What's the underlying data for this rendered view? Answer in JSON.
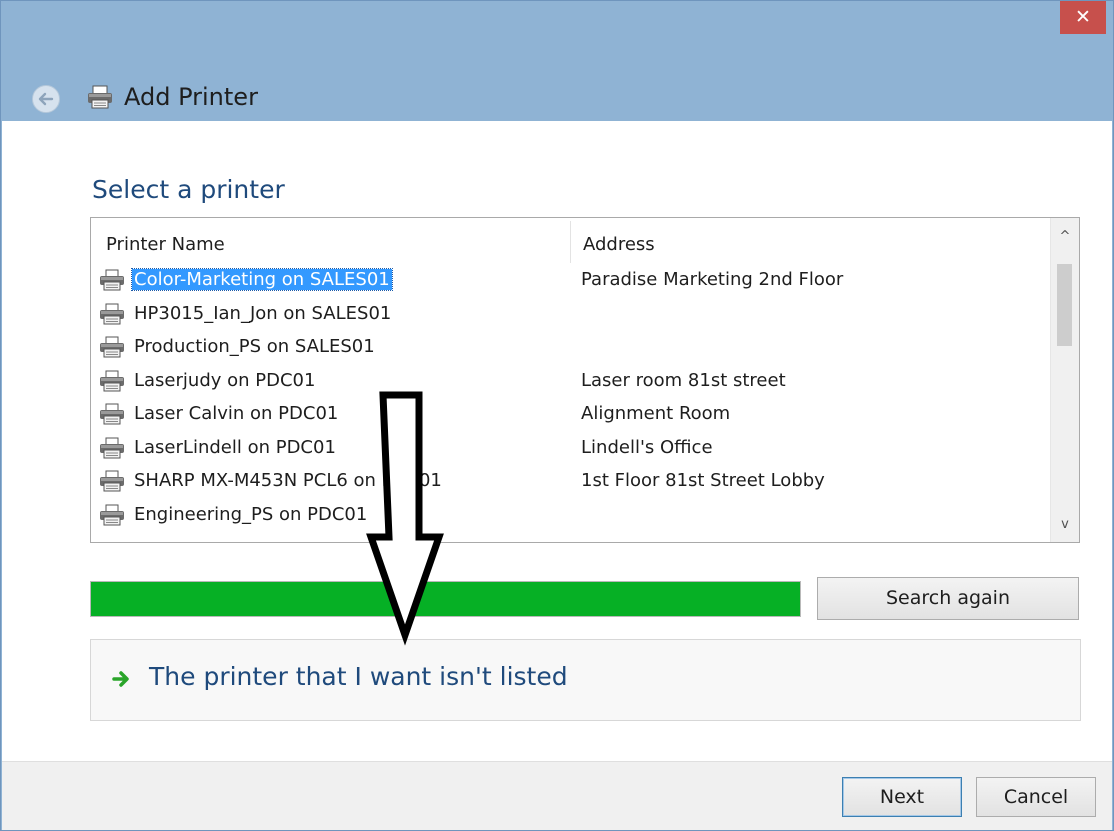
{
  "window": {
    "close_glyph": "✕",
    "title": "Add Printer",
    "title_icon": "printer-icon",
    "back_icon": "back-arrow-icon"
  },
  "main": {
    "heading": "Select a printer",
    "columns": {
      "name": "Printer Name",
      "address": "Address"
    },
    "printers": [
      {
        "name": "Color-Marketing on SALES01",
        "address": "Paradise Marketing 2nd Floor",
        "selected": true
      },
      {
        "name": "HP3015_Ian_Jon on SALES01",
        "address": ""
      },
      {
        "name": "Production_PS on SALES01",
        "address": ""
      },
      {
        "name": "Laserjudy on PDC01",
        "address": "Laser room 81st street"
      },
      {
        "name": "Laser Calvin on PDC01",
        "address": "Alignment Room"
      },
      {
        "name": "LaserLindell on PDC01",
        "address": "Lindell's Office"
      },
      {
        "name": "SHARP MX-M453N PCL6 on PDC01",
        "address": "1st Floor 81st Street Lobby"
      },
      {
        "name": "Engineering_PS on PDC01",
        "address": ""
      }
    ],
    "scroll_up_glyph": "^",
    "scroll_down_glyph": "v",
    "progress_fraction": 1.0,
    "search_again_label": "Search again",
    "not_listed_label": "The printer that I want isn't listed",
    "not_listed_icon": "green-arrow-icon",
    "annotation_icon": "down-arrow-annotation"
  },
  "footer": {
    "next_label": "Next",
    "cancel_label": "Cancel"
  },
  "colors": {
    "title_bar": "#8fb3d4",
    "close_button": "#c7504c",
    "heading_text": "#1f4a7c",
    "selection": "#3399ff",
    "progress": "#06b025"
  }
}
